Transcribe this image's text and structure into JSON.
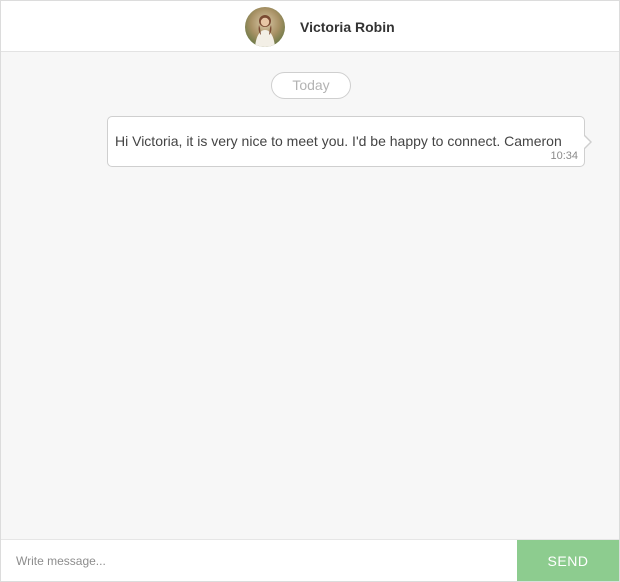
{
  "header": {
    "contact_name": "Victoria Robin",
    "avatar_icon": "user-photo-avatar"
  },
  "conversation": {
    "date_separator": "Today",
    "messages": [
      {
        "text": "Hi Victoria, it is very nice to meet you. I'd be happy to connect. Cameron",
        "time": "10:34",
        "direction": "outgoing"
      }
    ]
  },
  "composer": {
    "placeholder": "Write message...",
    "value": "",
    "send_label": "SEND"
  },
  "colors": {
    "send_button": "#8dcc8f",
    "background": "#f7f7f7",
    "bubble": "#ffffff"
  }
}
